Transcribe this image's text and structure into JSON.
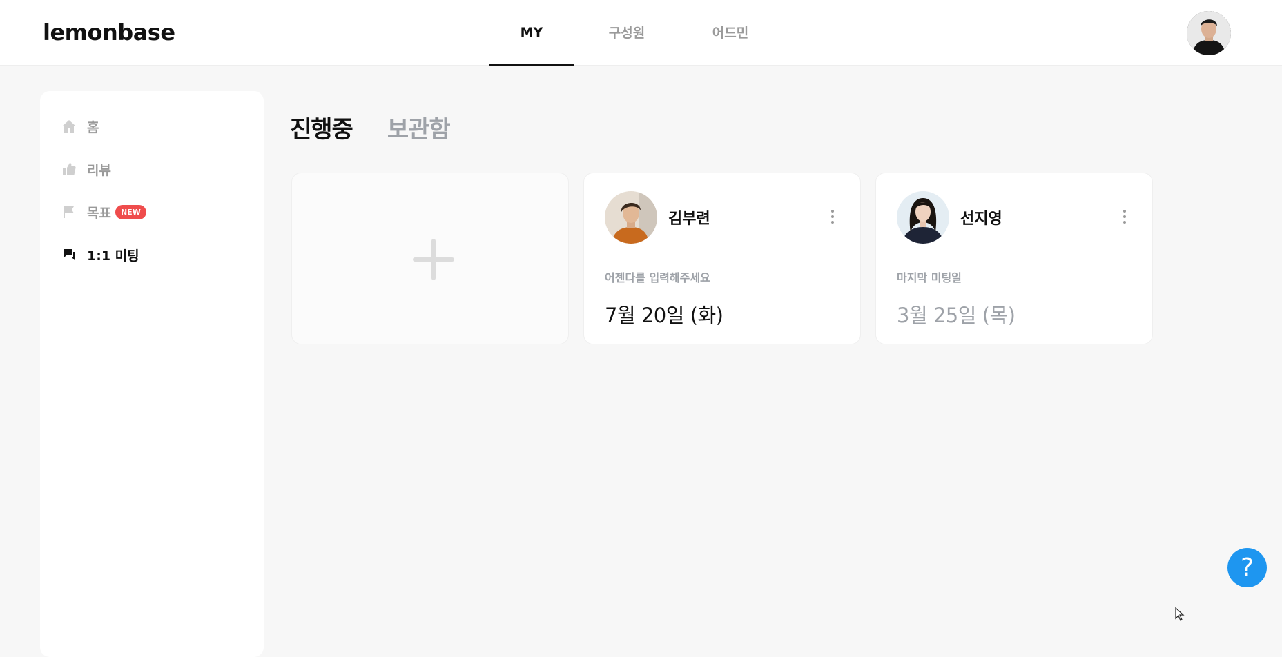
{
  "header": {
    "logo": "lemonbase",
    "tabs": [
      {
        "label": "MY",
        "active": true
      },
      {
        "label": "구성원",
        "active": false
      },
      {
        "label": "어드민",
        "active": false
      }
    ]
  },
  "sidebar": {
    "items": [
      {
        "label": "홈",
        "icon": "home-icon"
      },
      {
        "label": "리뷰",
        "icon": "thumbs-up-icon"
      },
      {
        "label": "목표",
        "icon": "flag-icon",
        "badge": "NEW"
      },
      {
        "label": "1:1 미팅",
        "icon": "chat-icon",
        "active": true
      }
    ]
  },
  "main": {
    "tabs": [
      {
        "label": "진행중",
        "active": true
      },
      {
        "label": "보관함",
        "active": false
      }
    ],
    "cards": [
      {
        "name": "김부련",
        "subtitle": "어젠다를 입력해주세요",
        "date": "7월 20일 (화)"
      },
      {
        "name": "선지영",
        "subtitle": "마지막 미팅일",
        "date": "3월 25일 (목)"
      }
    ]
  },
  "help": {
    "label": "?"
  },
  "colors": {
    "accent_blue": "#1e96f0",
    "badge_red": "#ef4c4c",
    "muted_text": "#9ea2a8",
    "background": "#f7f7f7"
  }
}
